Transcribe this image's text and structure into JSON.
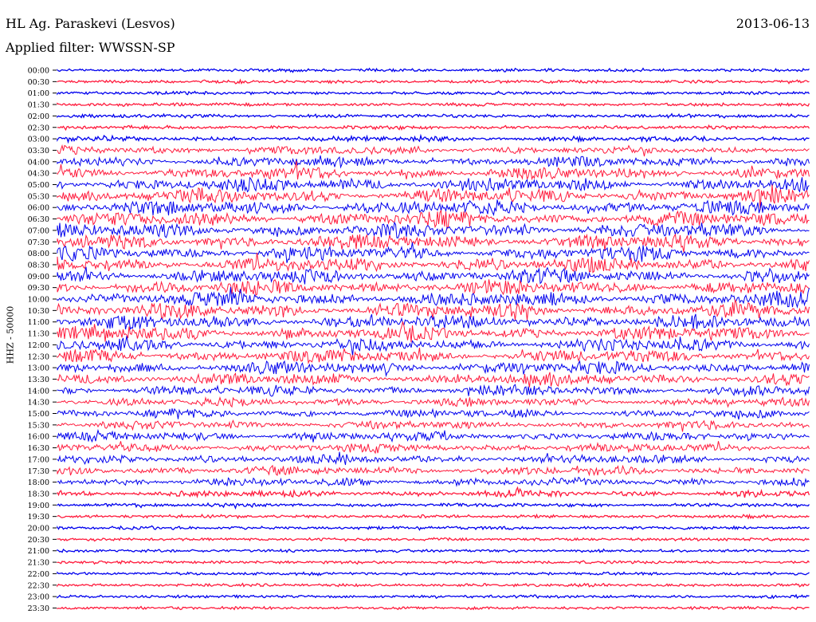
{
  "header": {
    "station": "HL Ag. Paraskevi (Lesvos)",
    "filter": "Applied filter: WWSSN-SP",
    "date": "2013-06-13"
  },
  "chart_data": {
    "type": "line",
    "title": "HL Ag. Paraskevi (Lesvos)",
    "channel_label": "HHZ - 50000",
    "trace_colors": [
      "#0000ee",
      "#ff1a3c"
    ],
    "row_labels": [
      "00:00",
      "00:30",
      "01:00",
      "01:30",
      "02:00",
      "02:30",
      "03:00",
      "03:30",
      "04:00",
      "04:30",
      "05:00",
      "05:30",
      "06:00",
      "06:30",
      "07:00",
      "07:30",
      "08:00",
      "08:30",
      "09:00",
      "09:30",
      "10:00",
      "10:30",
      "11:00",
      "11:30",
      "12:00",
      "12:30",
      "13:00",
      "13:30",
      "14:00",
      "14:30",
      "15:00",
      "15:30",
      "16:00",
      "16:30",
      "17:00",
      "17:30",
      "18:00",
      "18:30",
      "19:00",
      "19:30",
      "20:00",
      "20:30",
      "21:00",
      "21:30",
      "22:00",
      "22:30",
      "23:00",
      "23:30"
    ],
    "row_amplitude": [
      0.15,
      0.15,
      0.15,
      0.15,
      0.18,
      0.2,
      0.3,
      0.55,
      0.7,
      0.85,
      0.95,
      1.0,
      1.0,
      1.0,
      1.0,
      1.0,
      1.0,
      1.0,
      1.0,
      1.0,
      1.0,
      1.0,
      0.95,
      0.95,
      0.9,
      0.9,
      0.9,
      0.85,
      0.7,
      0.55,
      0.55,
      0.55,
      0.6,
      0.6,
      0.6,
      0.6,
      0.55,
      0.4,
      0.2,
      0.15,
      0.15,
      0.12,
      0.12,
      0.12,
      0.12,
      0.12,
      0.12,
      0.12
    ]
  }
}
